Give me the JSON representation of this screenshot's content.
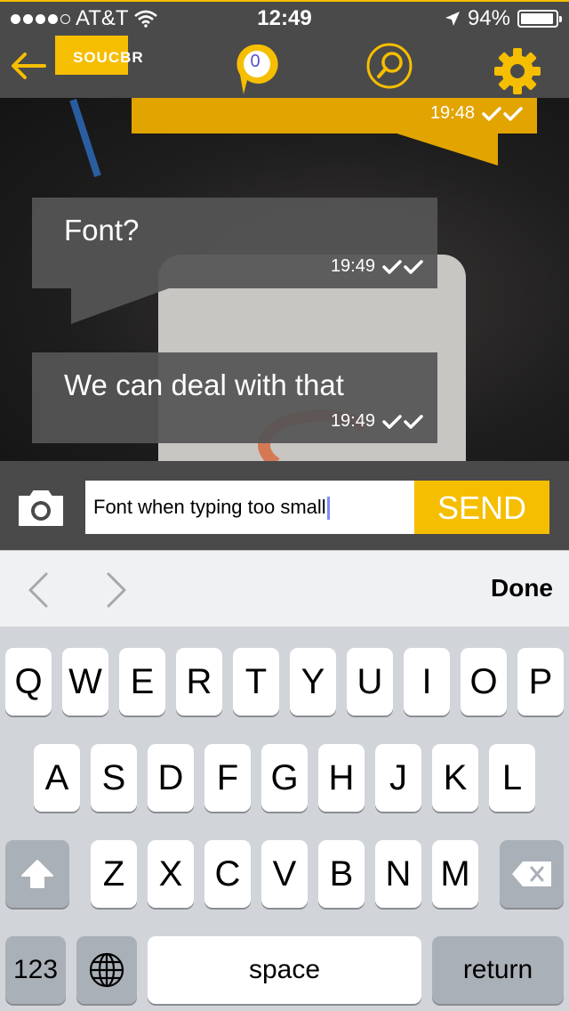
{
  "status_bar": {
    "carrier": "AT&T",
    "time": "12:49",
    "battery": "94%",
    "battery_level": 0.94,
    "signal_bars_filled": 4,
    "signal_bars_total": 5
  },
  "nav": {
    "logo_text": "SOUCBR",
    "notification_count": "0"
  },
  "messages": [
    {
      "type": "outgoing",
      "text": "",
      "time": "19:48"
    },
    {
      "type": "incoming",
      "text": "Font?",
      "time": "19:49"
    },
    {
      "type": "incoming",
      "text": "We can deal with that",
      "time": "19:49"
    }
  ],
  "composer": {
    "input_value": "Font when typing too small",
    "send_label": "SEND"
  },
  "accessory": {
    "done_label": "Done"
  },
  "keyboard": {
    "row1": [
      "Q",
      "W",
      "E",
      "R",
      "T",
      "Y",
      "U",
      "I",
      "O",
      "P"
    ],
    "row2": [
      "A",
      "S",
      "D",
      "F",
      "G",
      "H",
      "J",
      "K",
      "L"
    ],
    "row3": [
      "Z",
      "X",
      "C",
      "V",
      "B",
      "N",
      "M"
    ],
    "numbers_label": "123",
    "space_label": "space",
    "return_label": "return"
  },
  "colors": {
    "accent": "#f6be00",
    "bar_bg": "#4a4a4a",
    "bubble_in": "#555555",
    "bubble_out": "#e2a400"
  },
  "icons": {
    "back": "arrow-left-icon",
    "bubble": "chat-bubble-icon",
    "search": "search-icon",
    "settings": "gear-icon",
    "camera": "camera-icon",
    "prev": "chevron-left-icon",
    "next": "chevron-right-icon",
    "shift": "shift-icon",
    "delete": "backspace-icon",
    "globe": "globe-icon"
  }
}
